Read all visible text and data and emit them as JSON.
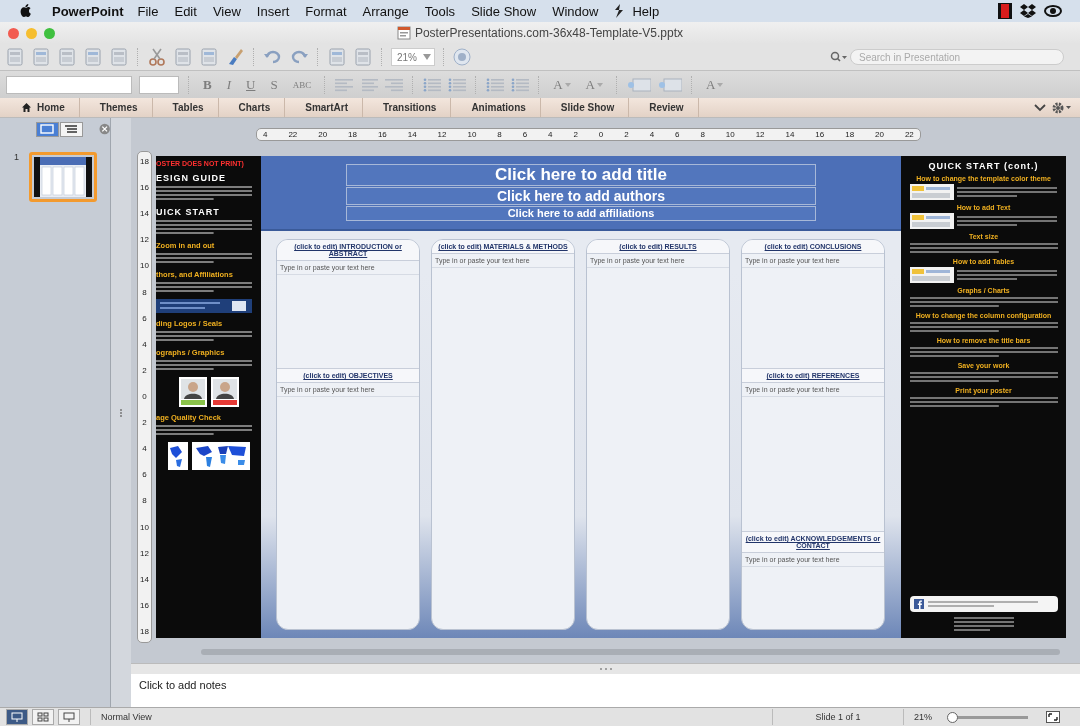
{
  "menu_bar": {
    "app": "PowerPoint",
    "items": [
      "File",
      "Edit",
      "View",
      "Insert",
      "Format",
      "Arrange",
      "Tools",
      "Slide Show",
      "Window",
      "Help"
    ]
  },
  "window": {
    "title": "PosterPresentations.com-36x48-Template-V5.pptx"
  },
  "toolbar": {
    "zoom": "21%",
    "search": {
      "placeholder": "Search in Presentation"
    }
  },
  "format_bar": {
    "style_buttons": [
      "B",
      "I",
      "U",
      "S",
      "ABC"
    ],
    "size_buttons": [
      "A",
      "A"
    ],
    "color_button": "A"
  },
  "ribbon_tabs": [
    {
      "label": "Home",
      "selected": false
    },
    {
      "label": "Themes",
      "selected": false
    },
    {
      "label": "Tables",
      "selected": false
    },
    {
      "label": "Charts",
      "selected": false
    },
    {
      "label": "SmartArt",
      "selected": false
    },
    {
      "label": "Transitions",
      "selected": false
    },
    {
      "label": "Animations",
      "selected": false
    },
    {
      "label": "Slide Show",
      "selected": false
    },
    {
      "label": "Review",
      "selected": false
    }
  ],
  "slides_panel": {
    "views": [
      {
        "selected": true
      },
      {
        "selected": false
      }
    ],
    "slides": [
      {
        "number": "1",
        "selected": true
      }
    ]
  },
  "ruler": {
    "horizontal": [
      "4",
      "22",
      "20",
      "18",
      "16",
      "14",
      "12",
      "10",
      "8",
      "6",
      "4",
      "2",
      "0",
      "2",
      "4",
      "6",
      "8",
      "10",
      "12",
      "14",
      "16",
      "18",
      "20",
      "22"
    ],
    "vertical": [
      "18",
      "16",
      "14",
      "12",
      "10",
      "8",
      "6",
      "4",
      "2",
      "0",
      "2",
      "4",
      "6",
      "8",
      "10",
      "12",
      "14",
      "16",
      "18"
    ]
  },
  "slide": {
    "left_panel": {
      "notice": "OSTER DOES NOT PRINT)",
      "sections": [
        {
          "heading": "ESIGN GUIDE",
          "kind": "title"
        },
        {
          "heading": "UICK START",
          "kind": "title"
        },
        {
          "heading": "Zoom in and out",
          "kind": "topic"
        },
        {
          "heading": "thors, and Affiliations",
          "kind": "topic"
        },
        {
          "kind": "banner"
        },
        {
          "heading": "ding Logos / Seals",
          "kind": "topic"
        },
        {
          "heading": "ographs / Graphics",
          "kind": "topic"
        },
        {
          "kind": "portraits"
        },
        {
          "heading": "age Quality Check",
          "kind": "topic"
        },
        {
          "kind": "maps"
        }
      ]
    },
    "title": "Click here to add title",
    "authors": "Click here to add authors",
    "affiliations": "Click here to add affiliations",
    "columns": [
      {
        "sections": [
          {
            "heading": "(click to edit)  INTRODUCTION or ABSTRACT",
            "hint": "Type in or paste your text here"
          },
          {
            "heading": "(click to edit)  OBJECTIVES",
            "hint": "Type in or paste your text here"
          }
        ]
      },
      {
        "sections": [
          {
            "heading": "(click to edit)  MATERIALS & METHODS",
            "hint": "Type in or paste your text here"
          }
        ]
      },
      {
        "sections": [
          {
            "heading": "(click to edit)  RESULTS",
            "hint": "Type in or paste your text here"
          }
        ]
      },
      {
        "sections": [
          {
            "heading": "(click to edit)  CONCLUSIONS",
            "hint": "Type in or paste your text here"
          },
          {
            "heading": "(click to edit)  REFERENCES",
            "hint": "Type in or paste your text here"
          },
          {
            "heading": "(click to edit)  ACKNOWLEDGEMENTS or  CONTACT",
            "hint": "Type in or paste your text here"
          }
        ]
      }
    ],
    "right_panel": {
      "title": "QUICK START (cont.)",
      "sections": [
        {
          "heading": "How to change the template color theme",
          "has_image": true
        },
        {
          "heading": "How to add Text",
          "has_image": true
        },
        {
          "heading": "Text size",
          "has_image": false
        },
        {
          "heading": "How to add Tables",
          "has_image": true
        },
        {
          "heading": "Graphs / Charts",
          "has_image": false
        },
        {
          "heading": "How to change the column configuration",
          "has_image": false
        },
        {
          "heading": "How to remove the title bars",
          "has_image": false
        },
        {
          "heading": "Save your work",
          "has_image": false
        },
        {
          "heading": "Print your poster",
          "has_image": false
        }
      ]
    }
  },
  "notes": {
    "placeholder": "Click to add notes"
  },
  "status_bar": {
    "views": [
      {
        "selected": true
      },
      {
        "selected": false
      },
      {
        "selected": false
      }
    ],
    "view_name": "Normal View",
    "slide": "Slide 1 of 1",
    "zoom": "21%",
    "zoom_slider": {
      "level": 0.04
    }
  }
}
